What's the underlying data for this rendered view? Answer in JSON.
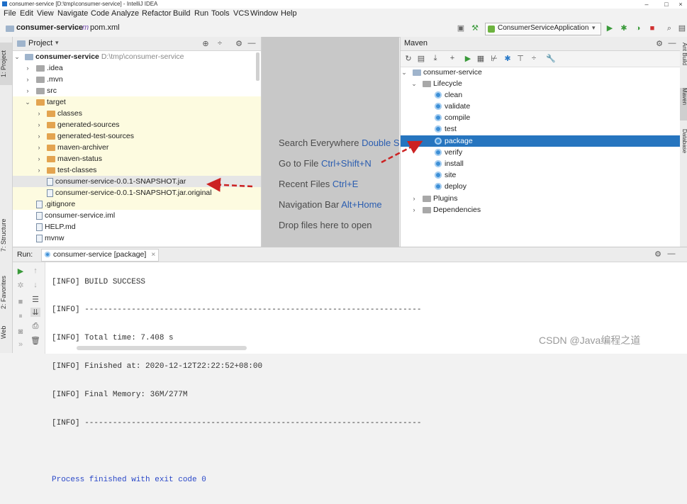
{
  "window": {
    "title": "consumer-service [D:\\tmp\\consumer-service] - IntelliJ IDEA",
    "minimize": "–",
    "maximize": "□",
    "close": "×"
  },
  "menu": [
    "File",
    "Edit",
    "View",
    "Navigate",
    "Code",
    "Analyze",
    "Refactor",
    "Build",
    "Run",
    "Tools",
    "VCS",
    "Window",
    "Help"
  ],
  "breadcrumb": {
    "project": "consumer-service",
    "file": "pom.xml"
  },
  "toolbar": {
    "run_config": "ConsumerServiceApplication"
  },
  "left_tabs": [
    "1: Project",
    "7: Structure",
    "2: Favorites",
    "Web"
  ],
  "right_tabs": [
    "Ant Build",
    "Maven",
    "Database"
  ],
  "project": {
    "header": "Project",
    "root": {
      "name": "consumer-service",
      "path": "D:\\tmp\\consumer-service"
    },
    "items": [
      {
        "label": ".idea"
      },
      {
        "label": ".mvn"
      },
      {
        "label": "src"
      },
      {
        "label": "target"
      },
      {
        "label": "classes"
      },
      {
        "label": "generated-sources"
      },
      {
        "label": "generated-test-sources"
      },
      {
        "label": "maven-archiver"
      },
      {
        "label": "maven-status"
      },
      {
        "label": "test-classes"
      },
      {
        "label": "consumer-service-0.0.1-SNAPSHOT.jar"
      },
      {
        "label": "consumer-service-0.0.1-SNAPSHOT.jar.original"
      },
      {
        "label": ".gitignore"
      },
      {
        "label": "consumer-service.iml"
      },
      {
        "label": "HELP.md"
      },
      {
        "label": "mvnw"
      }
    ]
  },
  "editor_hints": [
    {
      "text": "Search Everywhere",
      "key": "Double Shift"
    },
    {
      "text": "Go to File",
      "key": "Ctrl+Shift+N"
    },
    {
      "text": "Recent Files",
      "key": "Ctrl+E"
    },
    {
      "text": "Navigation Bar",
      "key": "Alt+Home"
    },
    {
      "text": "Drop files here to open",
      "key": ""
    }
  ],
  "maven": {
    "header": "Maven",
    "project": "consumer-service",
    "lifecycle": "Lifecycle",
    "goals": [
      "clean",
      "validate",
      "compile",
      "test",
      "package",
      "verify",
      "install",
      "site",
      "deploy"
    ],
    "selected": "package",
    "plugins": "Plugins",
    "dependencies": "Dependencies"
  },
  "run": {
    "label": "Run:",
    "tab": "consumer-service [package]",
    "console": [
      "[INFO] BUILD SUCCESS",
      "[INFO] ------------------------------------------------------------------------",
      "[INFO] Total time: 7.408 s",
      "[INFO] Finished at: 2020-12-12T22:22:52+08:00",
      "[INFO] Final Memory: 36M/277M",
      "[INFO] ------------------------------------------------------------------------",
      "",
      "Process finished with exit code 0"
    ]
  },
  "watermark": "CSDN @Java编程之道",
  "colors": {
    "selection": "#2675bf",
    "highlight_row": "#fdfbe0",
    "arrow": "#cc2222",
    "link": "#2a5db0"
  }
}
